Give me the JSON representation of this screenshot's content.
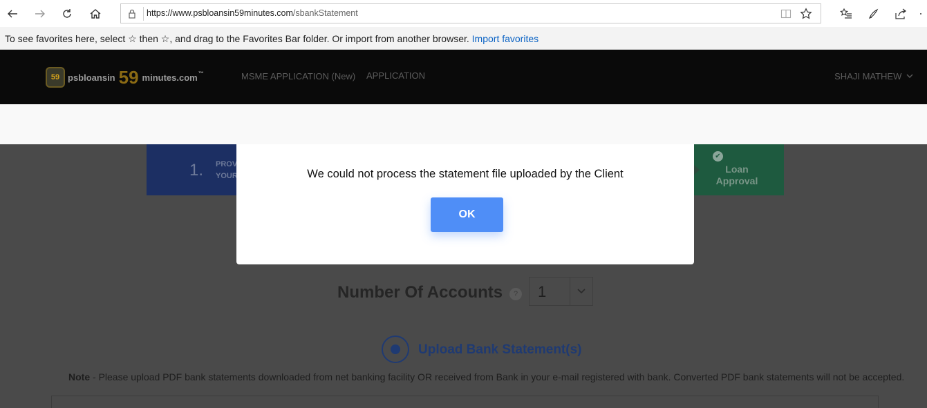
{
  "browser": {
    "url_host": "https://www.psbloansin59minutes.com",
    "url_path": "/sbankStatement",
    "favorites_bar": {
      "message_start": "To see favorites here, select",
      "message_icon": "☆",
      "message_end": "then ☆, and drag to the Favorites Bar folder. Or import from another browser.",
      "import_link": "Import favorites"
    },
    "icons": [
      "back-icon",
      "forward-icon",
      "refresh-icon",
      "home-icon",
      "lock-icon",
      "reading-view-icon",
      "favorite-star-icon",
      "favorites-list-icon",
      "pen-icon",
      "share-icon",
      "more-icon"
    ]
  },
  "site": {
    "logo": {
      "badge": "59",
      "part1": "psbloansin",
      "part2": "59",
      "part3": "minutes.com",
      "tm": "™"
    },
    "nav": {
      "msme": "MSME APPLICATION (New)",
      "application": "APPLICATION"
    },
    "user": "SHAJI MATHEW"
  },
  "steps": {
    "step1_number": "1.",
    "step1_line1": "PROV",
    "step1_line2": "YOUR",
    "final_label_line1": "Loan",
    "final_label_line2": "Approval"
  },
  "accounts": {
    "label": "Number Of Accounts",
    "help": "?",
    "value": "1"
  },
  "upload": {
    "label": "Upload Bank Statement(s)",
    "note_label": "Note",
    "note_text": " - Please upload PDF bank statements downloaded from net banking facility OR received from Bank in your e-mail registered with bank. Converted PDF bank statements will not be accepted."
  },
  "modal": {
    "message": "We could not process the statement file uploaded by the Client",
    "ok_label": "OK"
  },
  "colors": {
    "accent": "#4f8ef7",
    "overlay": "#4a4a4a",
    "header": "#0a0a0a",
    "link": "#0b63c4"
  }
}
